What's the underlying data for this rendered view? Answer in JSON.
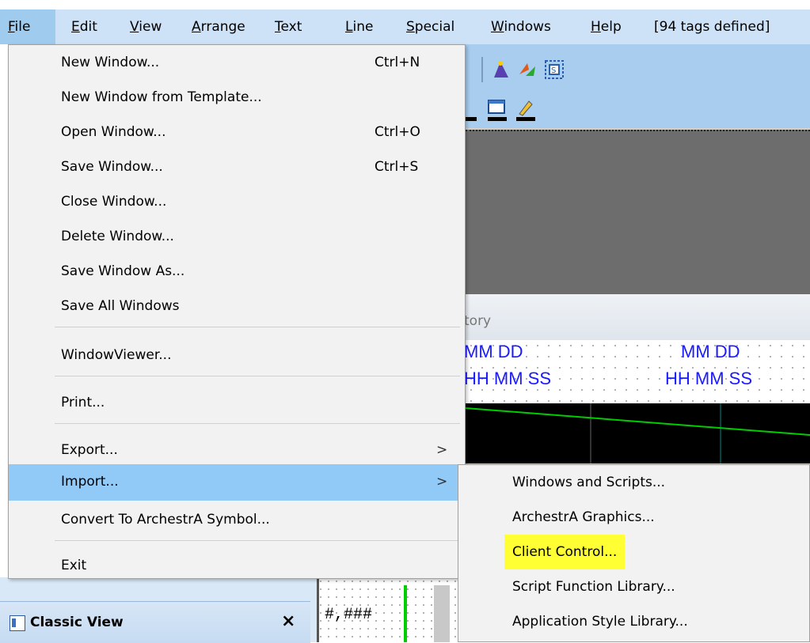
{
  "menubar": {
    "items": [
      {
        "label": "File",
        "mnemonic": "F",
        "rest": "ile"
      },
      {
        "label": "Edit",
        "mnemonic": "E",
        "rest": "dit"
      },
      {
        "label": "View",
        "mnemonic": "V",
        "rest": "iew"
      },
      {
        "label": "Arrange",
        "mnemonic": "A",
        "rest": "rrange"
      },
      {
        "label": "Text",
        "mnemonic": "T",
        "rest": "ext"
      },
      {
        "label": "Line",
        "mnemonic": "L",
        "rest": "ine"
      },
      {
        "label": "Special",
        "mnemonic": "S",
        "rest": "pecial"
      },
      {
        "label": "Windows",
        "mnemonic": "W",
        "rest": "indows"
      },
      {
        "label": "Help",
        "mnemonic": "H",
        "rest": "elp"
      }
    ],
    "tag_count": "[94 tags defined]"
  },
  "file_menu": {
    "items": [
      {
        "label": "New Window...",
        "shortcut": "Ctrl+N"
      },
      {
        "label": "New Window from Template..."
      },
      {
        "label": "Open Window...",
        "shortcut": "Ctrl+O"
      },
      {
        "label": "Save Window...",
        "shortcut": "Ctrl+S"
      },
      {
        "label": "Close Window..."
      },
      {
        "label": "Delete Window..."
      },
      {
        "label": "Save Window As..."
      },
      {
        "label": "Save All Windows"
      },
      {
        "label": "WindowViewer..."
      },
      {
        "label": "Print..."
      },
      {
        "label": "Export..."
      },
      {
        "label": "Import..."
      },
      {
        "label": "Convert To ArchestrA Symbol..."
      },
      {
        "label": "Exit"
      }
    ],
    "submenu_arrow": ">"
  },
  "import_submenu": {
    "items": [
      {
        "label": "Windows and Scripts..."
      },
      {
        "label": "ArchestrA Graphics..."
      },
      {
        "label": "Client Control..."
      },
      {
        "label": "Script Function Library..."
      },
      {
        "label": "Application Style Library..."
      }
    ]
  },
  "background": {
    "trend_title_fragment": "tory",
    "trend_labels": [
      "MM DD",
      "MM DD",
      "HH MM SS",
      "HH MM SS"
    ],
    "number_format": "#,###"
  },
  "classic_view": {
    "title": "Classic View",
    "close": "×"
  },
  "colors": {
    "menubar_bg": "#cde1f7",
    "highlight": "#91c9f7",
    "yellow_highlight": "#ffff33",
    "trend_text": "#1a1aff"
  }
}
